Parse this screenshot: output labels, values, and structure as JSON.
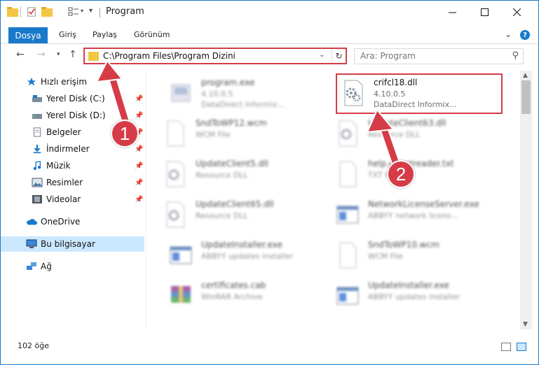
{
  "window": {
    "title": "Program"
  },
  "ribbon": {
    "tabs": [
      {
        "label": "Dosya"
      },
      {
        "label": "Giriş"
      },
      {
        "label": "Paylaş"
      },
      {
        "label": "Görünüm"
      }
    ],
    "help_label": "?"
  },
  "address": {
    "path": "C:\\Program Files\\Program Dizini",
    "search_placeholder": "Ara: Program"
  },
  "sidebar": {
    "quick_access": "Hızlı erişim",
    "items": [
      {
        "label": "Yerel Disk (C:)"
      },
      {
        "label": "Yerel Disk (D:)"
      },
      {
        "label": "Belgeler"
      },
      {
        "label": "İndirmeler"
      },
      {
        "label": "Müzik"
      },
      {
        "label": "Resimler"
      },
      {
        "label": "Videolar"
      }
    ],
    "onedrive": "OneDrive",
    "this_pc": "Bu bilgisayar",
    "network": "Ağ"
  },
  "files": [
    {
      "name": "program.exe",
      "line1": "4.10.0.5",
      "line2": "DataDirect Informix...",
      "icon": "exe-icon"
    },
    {
      "name": "crifcl18.dll",
      "line1": "4.10.0.5",
      "line2": "DataDirect Informix...",
      "icon": "dll-gear-icon"
    },
    {
      "name": "SndToWP12.wcm",
      "line1": "WCM File",
      "line2": "",
      "icon": "blank-file-icon"
    },
    {
      "name": "UpdateClient63.dll",
      "line1": "Resource DLL",
      "line2": "",
      "icon": "dll-gear-icon"
    },
    {
      "name": "UpdateClient5.dll",
      "line1": "Resource DLL",
      "line2": "",
      "icon": "dll-gear-icon"
    },
    {
      "name": "help.eventreader.txt",
      "line1": "TXT File",
      "line2": "",
      "icon": "blank-file-icon"
    },
    {
      "name": "UpdateClient65.dll",
      "line1": "Resource DLL",
      "line2": "",
      "icon": "dll-gear-icon"
    },
    {
      "name": "NetworkLicenseServer.exe",
      "line1": "ABBYY network licens...",
      "line2": "",
      "icon": "window-app-icon"
    },
    {
      "name": "UpdateInstaller.exe",
      "line1": "ABBYY updates installer",
      "line2": "",
      "icon": "window-app-icon"
    },
    {
      "name": "SndToWP10.wcm",
      "line1": "WCM File",
      "line2": "",
      "icon": "blank-file-icon"
    },
    {
      "name": "certificates.cab",
      "line1": "WinRAR Archive",
      "line2": "",
      "icon": "winrar-icon"
    },
    {
      "name": "UpdateInstaller.exe",
      "line1": "ABBYY updates installer",
      "line2": "",
      "icon": "window-app-icon"
    }
  ],
  "status": {
    "count": "102 öğe"
  },
  "annotations": [
    {
      "label": "1"
    },
    {
      "label": "2"
    }
  ],
  "colors": {
    "accent": "#1979ca",
    "highlight": "#d63c47",
    "selection": "#cce8ff"
  }
}
